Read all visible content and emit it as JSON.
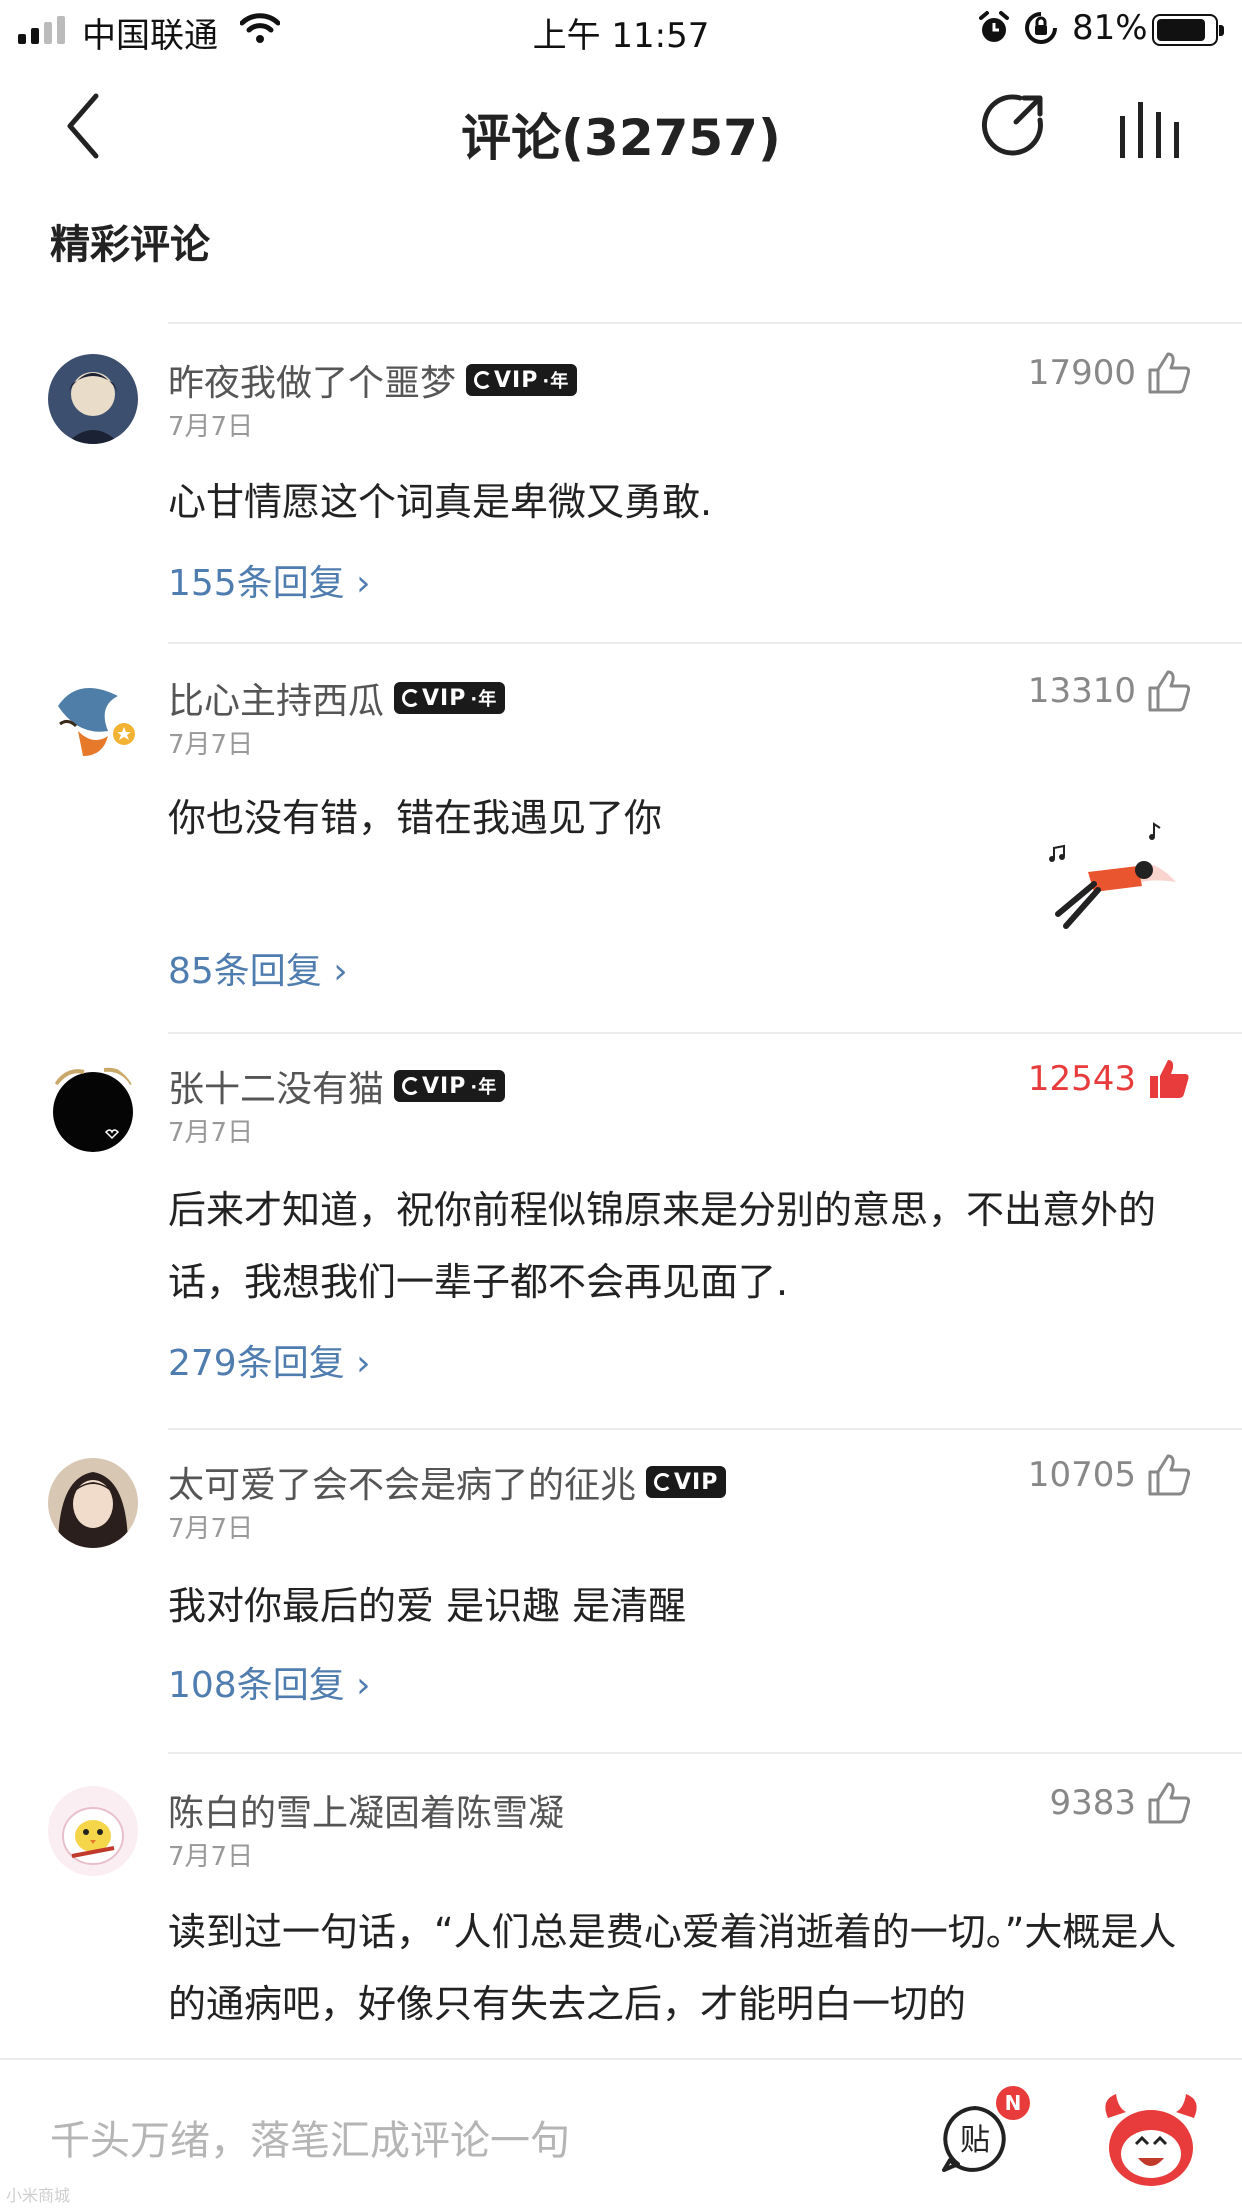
{
  "status_bar": {
    "carrier": "中国联通",
    "time": "上午 11:57",
    "battery": "81%",
    "icons": [
      "signal-icon",
      "wifi-icon",
      "alarm-icon",
      "rotation-lock-icon",
      "battery-icon"
    ]
  },
  "nav": {
    "title": "评论(32757)",
    "icons": [
      "back-icon",
      "share-icon",
      "now-playing-icon"
    ]
  },
  "section_title": "精彩评论",
  "vip_badge": "VIP",
  "vip_year": "·年",
  "comments": [
    {
      "user": "昨夜我做了个噩梦",
      "date": "7月7日",
      "likes": "17900",
      "text": "心甘情愿这个词真是卑微又勇敢.",
      "replies": "155条回复",
      "vip_year": true,
      "liked": false
    },
    {
      "user": "比心主持西瓜",
      "date": "7月7日",
      "likes": "13310",
      "text": "你也没有错，错在我遇见了你",
      "replies": "85条回复",
      "vip_year": true,
      "liked": false
    },
    {
      "user": "张十二没有猫",
      "date": "7月7日",
      "likes": "12543",
      "text": "后来才知道，祝你前程似锦原来是分别的意思，不出意外的话，我想我们一辈子都不会再见面了.",
      "replies": "279条回复",
      "vip_year": true,
      "liked": true
    },
    {
      "user": "太可爱了会不会是病了的征兆",
      "date": "7月7日",
      "likes": "10705",
      "text": "我对你最后的爱 是识趣 是清醒",
      "replies": "108条回复",
      "vip_year": false,
      "liked": false
    },
    {
      "user": "陈白的雪上凝固着陈雪凝",
      "date": "7月7日",
      "likes": "9383",
      "text": "读到过一句话，“人们总是费心爱着消逝着的一切。”大概是人的通病吧，好像只有失去之后，才能明白一切的",
      "replies": "",
      "vip_year": false,
      "liked": false
    }
  ],
  "bottom_bar": {
    "placeholder": "千头万绪，落笔汇成评论一句",
    "post_label": "贴",
    "badge": "N",
    "watermark": "小米商城"
  },
  "colors": {
    "accent_red": "#e83b3b",
    "reply_link": "#507daf",
    "muted": "#999999"
  }
}
